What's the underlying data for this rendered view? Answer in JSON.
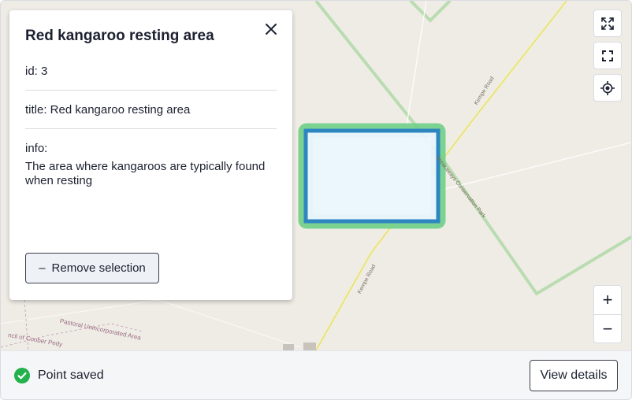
{
  "map": {
    "road_labels": [
      "Kempe Road",
      "Kempe Road",
      "Breakaways Conservation Park"
    ],
    "area_labels": [
      "Pastoral Unincorporated Area",
      "ncil of Coober Pedy"
    ],
    "colors": {
      "selection_fill": "#e6f4fb",
      "selection_stroke": "#2e86c1",
      "highlight": "#6fcf87"
    }
  },
  "panel": {
    "title": "Red kangaroo resting area",
    "close_icon": "close-icon",
    "id_label": "id: 3",
    "title_label": "title: Red kangaroo resting area",
    "info_label": "info:",
    "info_text": "The area where kangaroos are typically found when resting",
    "remove_symbol": "–",
    "remove_label": "Remove selection"
  },
  "controls": {
    "expand_icon": "expand-icon",
    "fullscreen_icon": "fullscreen-icon",
    "locate_icon": "locate-icon",
    "zoom_in": "+",
    "zoom_out": "−"
  },
  "status": {
    "icon": "check-circle-icon",
    "color": "#22b14c",
    "text": "Point saved",
    "button_label": "View details"
  }
}
